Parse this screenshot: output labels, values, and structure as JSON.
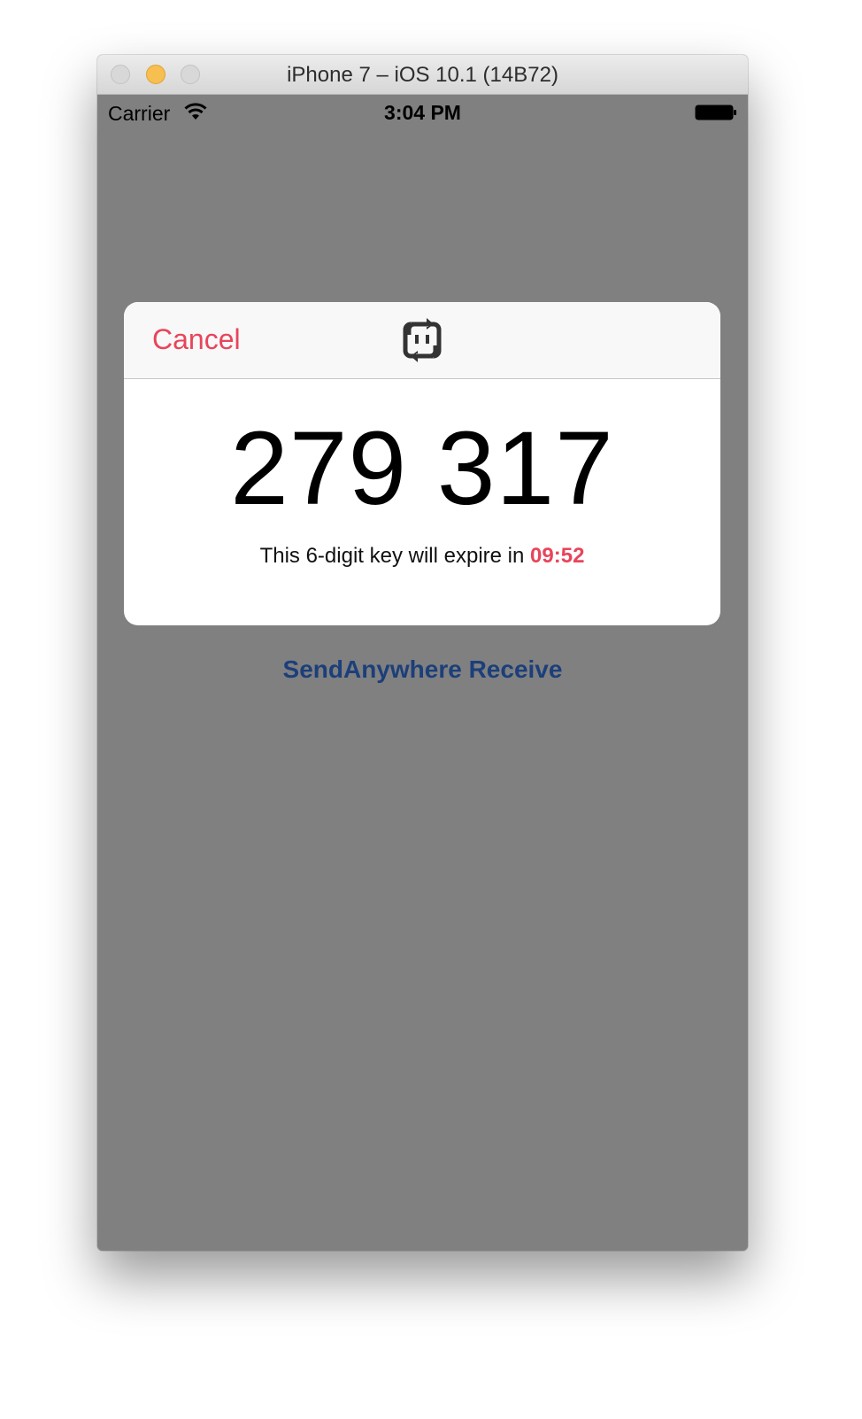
{
  "window": {
    "title": "iPhone 7 – iOS 10.1 (14B72)"
  },
  "status_bar": {
    "carrier": "Carrier",
    "time": "3:04 PM",
    "icons": [
      "wifi-icon",
      "battery-icon"
    ]
  },
  "dialog": {
    "cancel_label": "Cancel",
    "logo_icon": "sendanywhere-logo-icon",
    "key": "279 317",
    "expire_prefix": "This 6-digit key will expire in",
    "expire_time": "09:52"
  },
  "receive_button": {
    "label": "SendAnywhere Receive"
  },
  "colors": {
    "accent_red": "#e8455a",
    "link_blue": "#1c3f7a",
    "overlay_gray": "#808080"
  }
}
